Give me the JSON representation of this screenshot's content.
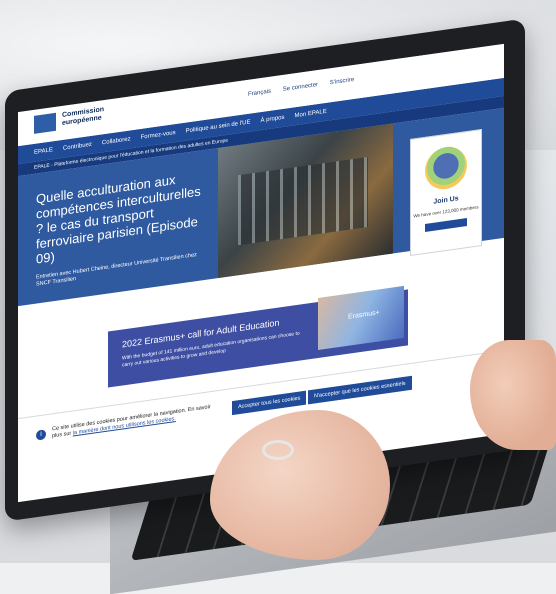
{
  "site": {
    "logo_line1": "Commission",
    "logo_line2": "européenne"
  },
  "languages": [
    "Français",
    "Se connecter",
    "S'inscrire"
  ],
  "nav": [
    "EPALE",
    "Contribuez",
    "Collaborez",
    "Formez-vous",
    "Politique au sein de l'UE",
    "À propos",
    "Mon EPALE"
  ],
  "breadcrumb": "EPALE - Plateforme électronique pour l'éducation et la formation des adultes en Europe",
  "hero": {
    "title": "Quelle acculturation aux compétences interculturelles ? le cas du transport ferroviaire parisien (Episode 09)",
    "subtitle": "Entretien avec Hubert Cheine, directeur Université Transilien chez SNCF Transilien"
  },
  "sidecard": {
    "title": "Join Us",
    "subtitle": "We have over 123,000 members"
  },
  "banner": {
    "title": "2022 Erasmus+ call for Adult Education",
    "body": "With the budget of 141 million euro, adult education organisations can choose to carry out various activities to grow and develop",
    "photo_label": "Erasmus+"
  },
  "cookie": {
    "text": "Ce site utilise des cookies pour améliorer la navigation. En savoir plus sur",
    "link": "la manière dont nous utilisons les cookies.",
    "accept_all": "Accepter tous les cookies",
    "accept_essential": "N'accepter que les cookies essentiels"
  }
}
